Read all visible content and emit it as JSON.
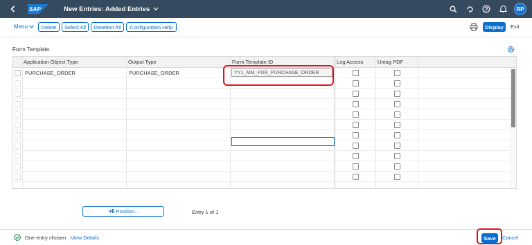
{
  "shell": {
    "app_title": "New Entries: Added Entries",
    "logo_text": "SAP",
    "avatar_initials": "RP"
  },
  "toolbar": {
    "menu_label": "Menu",
    "delete_label": "Delete",
    "select_all_label": "Select All",
    "deselect_all_label": "Deselect All",
    "configuration_help_label": "Configuration Help",
    "display_label": "Display",
    "exit_label": "Exit"
  },
  "section": {
    "title": "Form Template"
  },
  "table": {
    "columns": [
      "Application Object Type",
      "Output Type",
      "Form Template ID",
      "Log Access",
      "Untag PDF"
    ],
    "rows": [
      {
        "app_object_type": "PURCHASE_ORDER",
        "output_type": "PURCHASE_ORDER",
        "form_template_id": "YY1_MM_PUR_PURCHASE_ORDER",
        "log_access": false,
        "untag_pdf": false
      }
    ],
    "empty_row_count": 11
  },
  "bottom": {
    "position_label": "Position...",
    "entry_text": "Entry 1 of 1"
  },
  "footer": {
    "status_text": "One entry chosen",
    "view_details_label": "View Details",
    "save_label": "Save",
    "cancel_label": "Cancel"
  },
  "colors": {
    "shell_bg": "#354a5f",
    "accent": "#0a6ed1",
    "highlight": "#e0141e",
    "success": "#107e3e"
  },
  "icons": [
    "back-icon",
    "search-icon",
    "refresh-icon",
    "help-icon",
    "bell-icon",
    "print-icon",
    "settings-icon",
    "position-icon",
    "success-icon",
    "chevron-down-icon"
  ]
}
